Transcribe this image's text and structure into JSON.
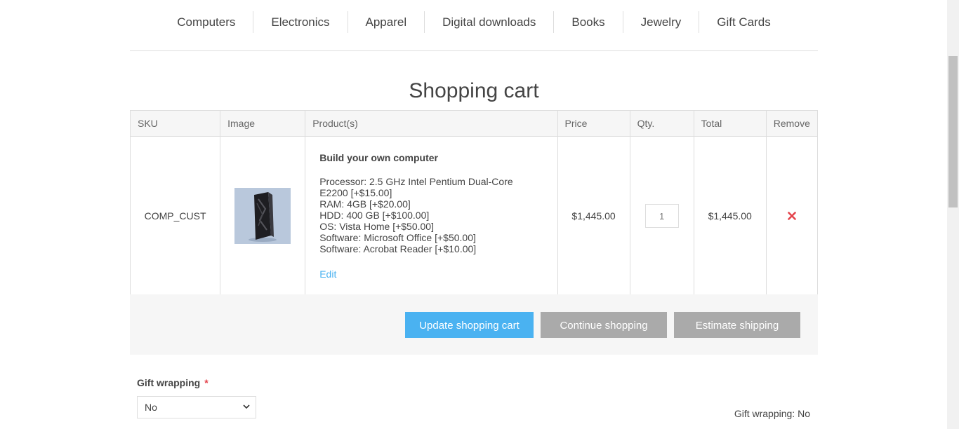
{
  "menu": {
    "items": [
      {
        "label": "Computers"
      },
      {
        "label": "Electronics"
      },
      {
        "label": "Apparel"
      },
      {
        "label": "Digital downloads"
      },
      {
        "label": "Books"
      },
      {
        "label": "Jewelry"
      },
      {
        "label": "Gift Cards"
      }
    ]
  },
  "page": {
    "title": "Shopping cart"
  },
  "cart": {
    "headers": {
      "sku": "SKU",
      "image": "Image",
      "products": "Product(s)",
      "price": "Price",
      "qty": "Qty.",
      "total": "Total",
      "remove": "Remove"
    },
    "rows": [
      {
        "sku": "COMP_CUST",
        "product_name": "Build your own computer",
        "attributes": [
          "Processor: 2.5 GHz Intel Pentium Dual-Core",
          "E2200 [+$15.00]",
          "RAM: 4GB [+$20.00]",
          "HDD: 400 GB [+$100.00]",
          "OS: Vista Home [+$50.00]",
          "Software: Microsoft Office [+$50.00]",
          "Software: Acrobat Reader [+$10.00]"
        ],
        "edit_label": "Edit",
        "price": "$1,445.00",
        "qty": "1",
        "total": "$1,445.00",
        "remove_icon": "close-x-icon"
      }
    ]
  },
  "buttons": {
    "update": "Update shopping cart",
    "continue": "Continue shopping",
    "estimate": "Estimate shipping"
  },
  "gift_wrapping": {
    "label": "Gift wrapping",
    "required_mark": "*",
    "selected": "No",
    "summary": "Gift wrapping: No"
  },
  "colors": {
    "accent": "#4ab2f1",
    "secondary_button": "#aaaaaa",
    "remove": "#e4434b"
  }
}
